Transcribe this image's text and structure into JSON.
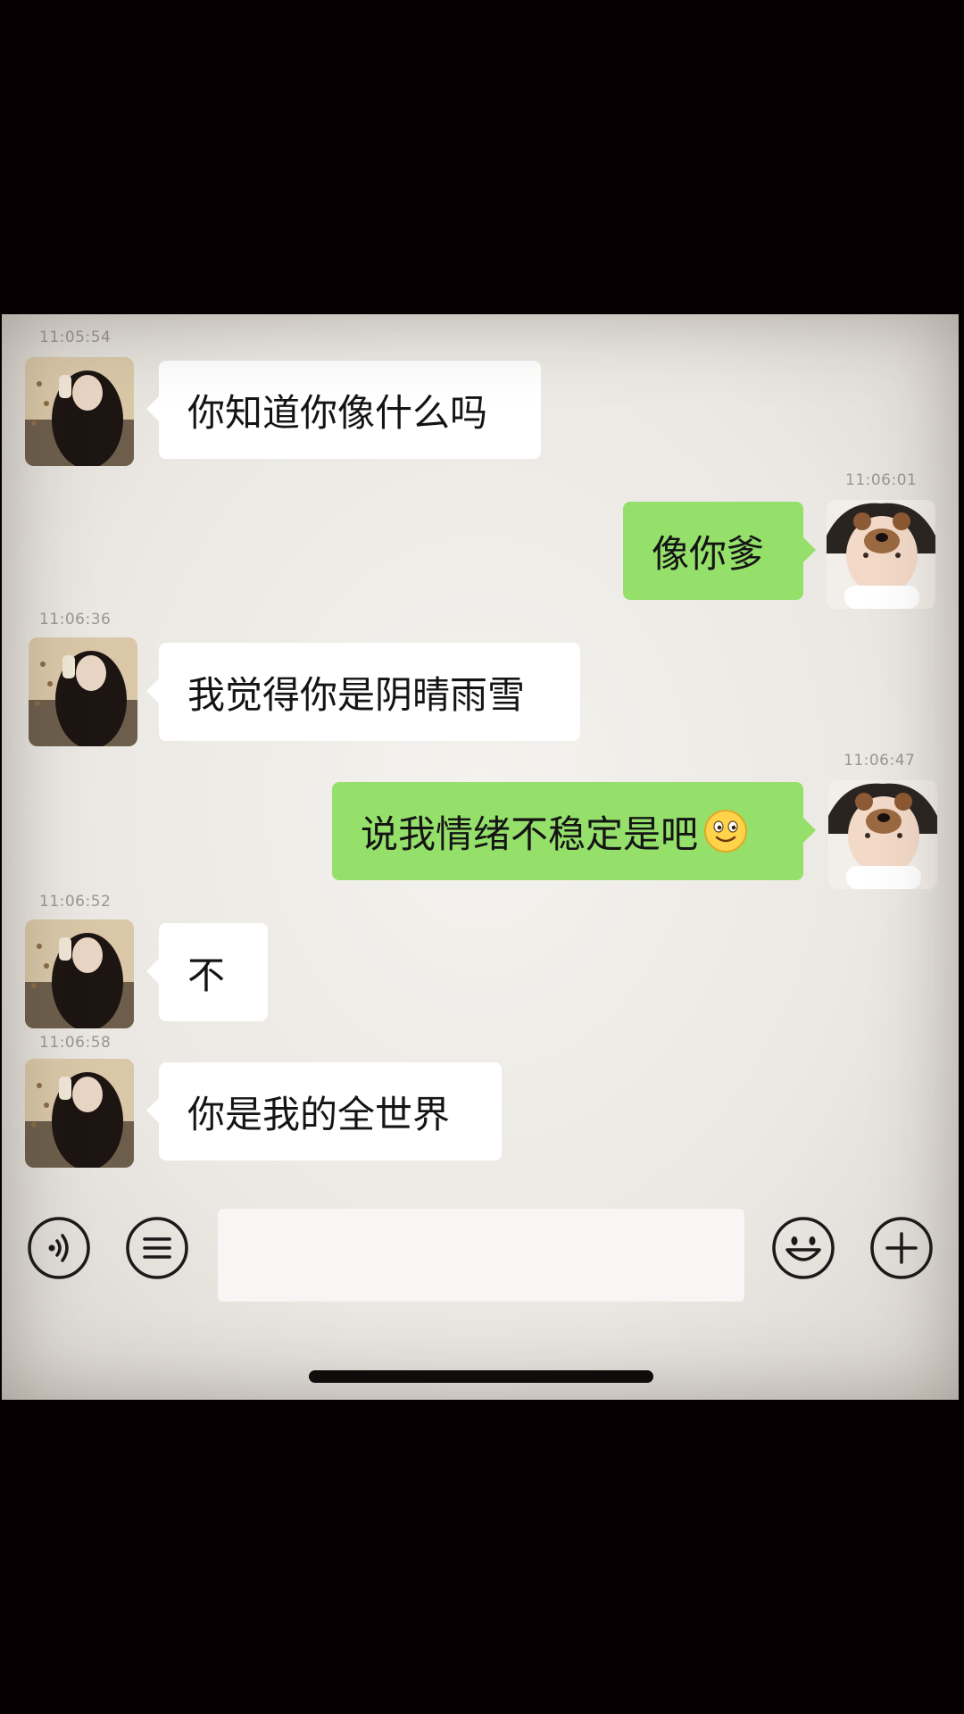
{
  "messages": [
    {
      "side": "left",
      "time": "11:05:54",
      "text": "你知道你像什么吗"
    },
    {
      "side": "right",
      "time": "11:06:01",
      "text": "像你爹"
    },
    {
      "side": "left",
      "time": "11:06:36",
      "text": "我觉得你是阴晴雨雪"
    },
    {
      "side": "right",
      "time": "11:06:47",
      "text": "说我情绪不稳定是吧",
      "emoji": "smiling-face-emoji"
    },
    {
      "side": "left",
      "time": "11:06:52",
      "text": "不"
    },
    {
      "side": "left",
      "time": "11:06:58",
      "text": "你是我的全世界"
    }
  ],
  "toolbar": {
    "voice_icon": "voice-icon",
    "menu_icon": "list-menu-icon",
    "input_value": "",
    "sticker_icon": "smiley-icon",
    "more_icon": "plus-icon"
  },
  "colors": {
    "outgoing_bubble": "#95e06a",
    "incoming_bubble": "#ffffff",
    "background": "#ebe8e3"
  }
}
